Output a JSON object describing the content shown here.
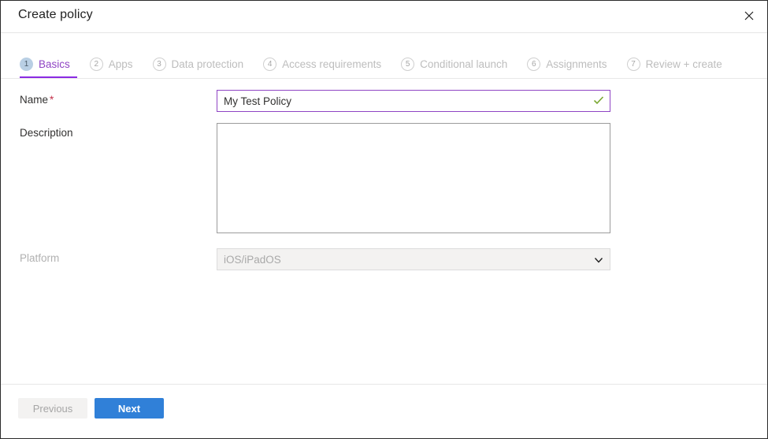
{
  "window": {
    "title": "Create policy",
    "close_icon": "close-icon"
  },
  "tabs": [
    {
      "number": "1",
      "label": "Basics",
      "active": true
    },
    {
      "number": "2",
      "label": "Apps",
      "active": false
    },
    {
      "number": "3",
      "label": "Data protection",
      "active": false
    },
    {
      "number": "4",
      "label": "Access requirements",
      "active": false
    },
    {
      "number": "5",
      "label": "Conditional launch",
      "active": false
    },
    {
      "number": "6",
      "label": "Assignments",
      "active": false
    },
    {
      "number": "7",
      "label": "Review + create",
      "active": false
    }
  ],
  "form": {
    "name": {
      "label": "Name",
      "required_marker": "*",
      "value": "My Test Policy",
      "placeholder": "",
      "validation_icon": "checkmark-icon"
    },
    "description": {
      "label": "Description",
      "value": "",
      "placeholder": ""
    },
    "platform": {
      "label": "Platform",
      "value": "iOS/iPadOS",
      "chevron_icon": "chevron-down-icon",
      "disabled": true
    }
  },
  "footer": {
    "previous_label": "Previous",
    "next_label": "Next"
  },
  "colors": {
    "accent_purple": "#8f44c4",
    "primary_blue": "#3080d8",
    "required_red": "#c4314b",
    "valid_green": "#7aa832"
  }
}
